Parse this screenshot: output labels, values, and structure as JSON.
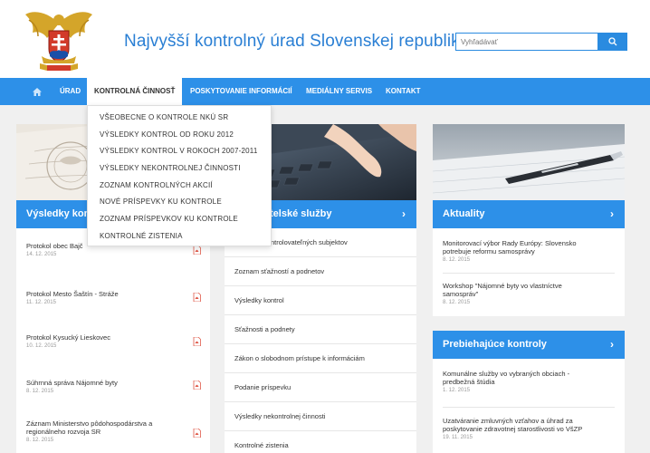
{
  "header": {
    "site_title": "Najvyšší kontrolný úrad Slovenskej republiky",
    "search_placeholder": "Vyhľadávať",
    "icons": {
      "logo": "coat-of-arms-eagle-logo",
      "search": "search-icon"
    }
  },
  "nav": {
    "home_icon": "home-icon",
    "items": [
      {
        "label": "ÚRAD"
      },
      {
        "label": "KONTROLNÁ ČINNOSŤ"
      },
      {
        "label": "POSKYTOVANIE INFORMÁCIÍ"
      },
      {
        "label": "MEDIÁLNY SERVIS"
      },
      {
        "label": "KONTAKT"
      }
    ]
  },
  "dropdown": {
    "items": [
      {
        "label": "VŠEOBECNE O KONTROLE NKÚ SR"
      },
      {
        "label": "VÝSLEDKY KONTROL OD ROKU 2012"
      },
      {
        "label": "VÝSLEDKY KONTROL V ROKOCH 2007-2011"
      },
      {
        "label": "VÝSLEDKY NEKONTROLNEJ ČINNOSTI"
      },
      {
        "label": "ZOZNAM KONTROLNÝCH AKCIÍ"
      },
      {
        "label": "NOVÉ PRÍSPEVKY KU KONTROLE"
      },
      {
        "label": "ZOZNAM PRÍSPEVKOV KU KONTROLE"
      },
      {
        "label": "KONTROLNÉ ZISTENIA"
      }
    ]
  },
  "results": {
    "heading": "Výsledky kon",
    "items": [
      {
        "title": "Protokol obec Bajč",
        "date": "14. 12. 2015"
      },
      {
        "title": "Protokol Mesto Šaštín - Stráže",
        "date": "11. 12. 2015"
      },
      {
        "title": "Protokol Kysucký Lieskovec",
        "date": "10. 12. 2015"
      },
      {
        "title": "Súhrnná správa Nájomné byty",
        "date": "8. 12. 2015"
      },
      {
        "title": "Záznam Ministerstvo pôdohospodárstva a",
        "title2": "regionálneho rozvoja SR",
        "date": "8. 12. 2015"
      }
    ]
  },
  "services": {
    "heading": "telské služby",
    "items": [
      {
        "label": "ntrolovateľných subjektov"
      },
      {
        "label": "Zoznam sťažností a podnetov"
      },
      {
        "label": "Výsledky kontrol"
      },
      {
        "label": "Sťažnosti a podnety"
      },
      {
        "label": "Zákon o slobodnom prístupe k informáciám"
      },
      {
        "label": "Podanie príspevku"
      },
      {
        "label": "Výsledky nekontrolnej činnosti"
      },
      {
        "label": "Kontrolné zistenia"
      }
    ]
  },
  "news": {
    "heading": "Aktuality",
    "items": [
      {
        "title": "Monitorovací výbor Rady Európy: Slovensko",
        "title2": "potrebuje reformu samosprávy",
        "date": "8. 12. 2015"
      },
      {
        "title": "Workshop \"Nájomné byty vo vlastníctve",
        "title2": "samospráv\"",
        "date": "8. 12. 2015"
      }
    ]
  },
  "ongoing": {
    "heading": "Prebiehajúce kontroly",
    "items": [
      {
        "title": "Komunálne služby vo vybraných obciach -",
        "title2": "predbežná štúdia",
        "date": "1. 12. 2015"
      },
      {
        "title": "Uzatváranie zmluvných vzťahov a úhrad za",
        "title2": "poskytovanie zdravotnej starostlivosti vo VšZP",
        "date": "19. 11. 2015"
      }
    ]
  },
  "colors": {
    "brand_blue": "#2d90e8",
    "title_blue": "#2a7fd4",
    "pdf_red": "#e05a4a"
  }
}
